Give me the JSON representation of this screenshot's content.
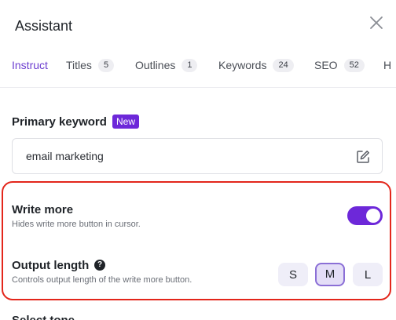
{
  "header": {
    "title": "Assistant",
    "close_icon": "close-icon"
  },
  "tabs": [
    {
      "label": "Instruct",
      "count": null,
      "active": true
    },
    {
      "label": "Titles",
      "count": "5"
    },
    {
      "label": "Outlines",
      "count": "1"
    },
    {
      "label": "Keywords",
      "count": "24"
    },
    {
      "label": "SEO",
      "count": "52"
    },
    {
      "label": "H"
    }
  ],
  "primary_keyword": {
    "label": "Primary keyword",
    "badge": "New",
    "value": "email marketing",
    "edit_icon": "edit-icon"
  },
  "write_more": {
    "label": "Write more",
    "description": "Hides write more button in cursor.",
    "enabled": true
  },
  "output_length": {
    "label": "Output length",
    "help_icon": "?",
    "description": "Controls output length of the write more button.",
    "options": [
      "S",
      "M",
      "L"
    ],
    "selected": "M"
  },
  "next_section": {
    "label": "Select tone"
  },
  "colors": {
    "accent": "#6d28d9",
    "highlight": "#e3261b"
  }
}
